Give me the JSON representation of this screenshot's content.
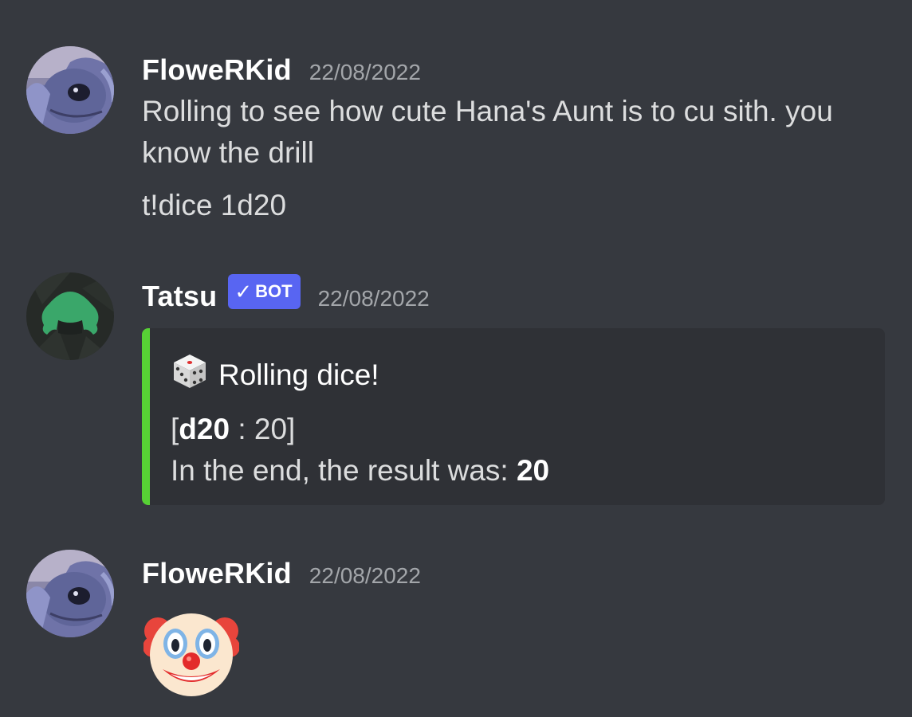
{
  "messages": [
    {
      "username": "FloweRKid",
      "timestamp": "22/08/2022",
      "lines": [
        "Rolling to see how cute Hana's Aunt is to cu sith. you",
        "know the drill"
      ],
      "command": "t!dice 1d20"
    },
    {
      "username": "Tatsu",
      "bot_tag": "BOT",
      "timestamp": "22/08/2022",
      "embed": {
        "accent_color": "#57d135",
        "title": "Rolling dice!",
        "title_icon": "game-die-icon",
        "roll_open": "[",
        "roll_die": "d20",
        "roll_sep": " : 20]",
        "result_prefix": "In the end, the result was: ",
        "result_value": "20"
      }
    },
    {
      "username": "FloweRKid",
      "timestamp": "22/08/2022",
      "emoji": "clown-face-emoji"
    }
  ],
  "colors": {
    "background": "#36393f",
    "embed_background": "#2f3136",
    "bot_tag": "#5865f2",
    "timestamp": "#a3a6aa"
  }
}
